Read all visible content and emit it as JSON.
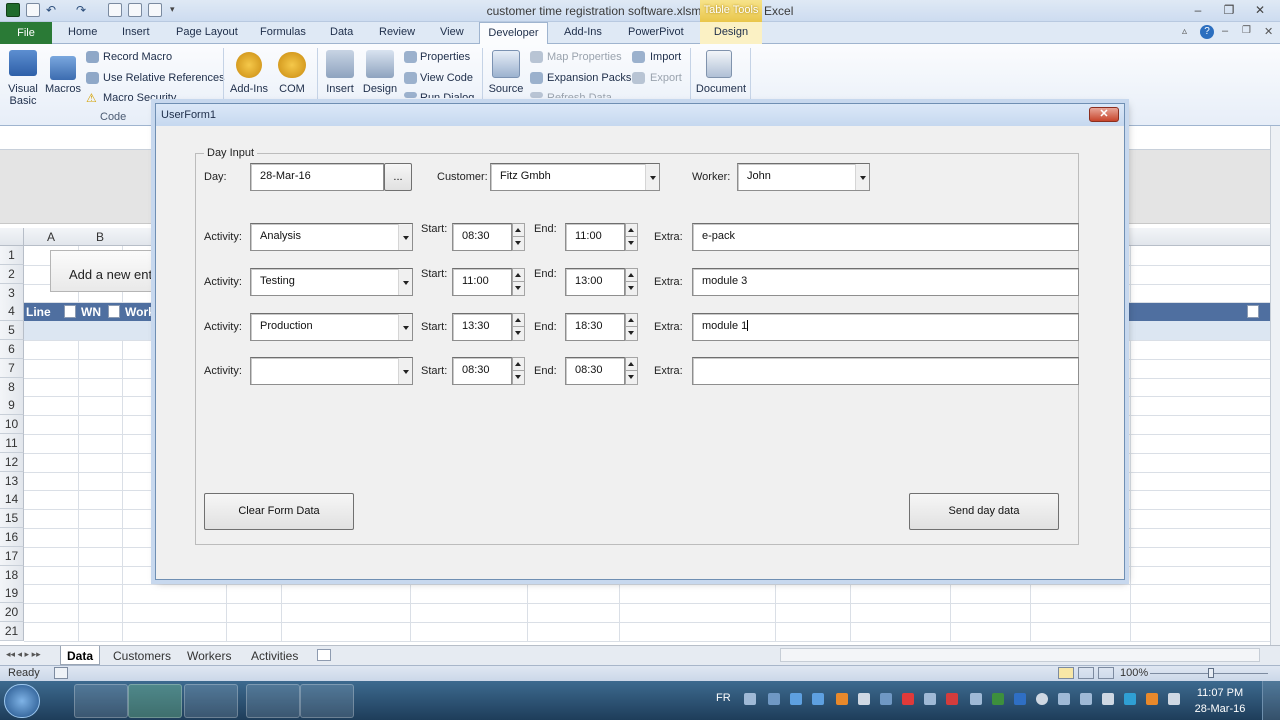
{
  "window": {
    "title": "customer time registration software.xlsm - Microsoft Excel",
    "context_tab_group": "Table Tools"
  },
  "ribbon_tabs": [
    "File",
    "Home",
    "Insert",
    "Page Layout",
    "Formulas",
    "Data",
    "Review",
    "View",
    "Developer",
    "Add-Ins",
    "PowerPivot",
    "Design"
  ],
  "ribbon": {
    "code": {
      "visual_basic": "Visual Basic",
      "macros": "Macros",
      "record_macro": "Record Macro",
      "use_relative": "Use Relative References",
      "macro_security": "Macro Security",
      "group_label": "Code"
    },
    "addins": {
      "addins": "Add-Ins",
      "com_addins": "COM Add-Ins"
    },
    "controls": {
      "insert": "Insert",
      "design_mode": "Design Mode",
      "properties": "Properties",
      "view_code": "View Code",
      "run_dialog": "Run Dialog"
    },
    "xml": {
      "source": "Source",
      "map_properties": "Map Properties",
      "expansion_packs": "Expansion Packs",
      "refresh_data": "Refresh Data",
      "import": "Import",
      "export": "Export"
    },
    "modify": {
      "document_panel": "Document Panel"
    }
  },
  "sheet": {
    "columns": [
      "A",
      "B"
    ],
    "rows": [
      "1",
      "2",
      "3",
      "4",
      "5",
      "6",
      "7",
      "8",
      "9",
      "10",
      "11",
      "12",
      "13",
      "14",
      "15",
      "16",
      "17",
      "18",
      "19",
      "20",
      "21"
    ],
    "add_entry_button": "Add a new entry",
    "table_headers": [
      "Line",
      "WN",
      "Work"
    ]
  },
  "sheet_tabs": [
    "Data",
    "Customers",
    "Workers",
    "Activities"
  ],
  "status": {
    "ready": "Ready",
    "zoom": "100%"
  },
  "taskbar": {
    "lang": "FR",
    "time": "11:07 PM",
    "date": "28-Mar-16"
  },
  "userform": {
    "title": "UserForm1",
    "frame_caption": "Day Input",
    "day_label": "Day:",
    "day_value": "28-Mar-16",
    "day_picker": "...",
    "customer_label": "Customer:",
    "customer_value": "Fitz Gmbh",
    "worker_label": "Worker:",
    "worker_value": "John",
    "activity_label": "Activity:",
    "start_label": "Start:",
    "end_label": "End:",
    "extra_label": "Extra:",
    "rows": [
      {
        "activity": "Analysis",
        "start": "08:30",
        "end": "11:00",
        "extra": "e-pack"
      },
      {
        "activity": "Testing",
        "start": "11:00",
        "end": "13:00",
        "extra": "module 3"
      },
      {
        "activity": "Production",
        "start": "13:30",
        "end": "18:30",
        "extra": "module 1"
      },
      {
        "activity": "",
        "start": "08:30",
        "end": "08:30",
        "extra": ""
      }
    ],
    "clear_button": "Clear Form Data",
    "send_button": "Send day data"
  }
}
